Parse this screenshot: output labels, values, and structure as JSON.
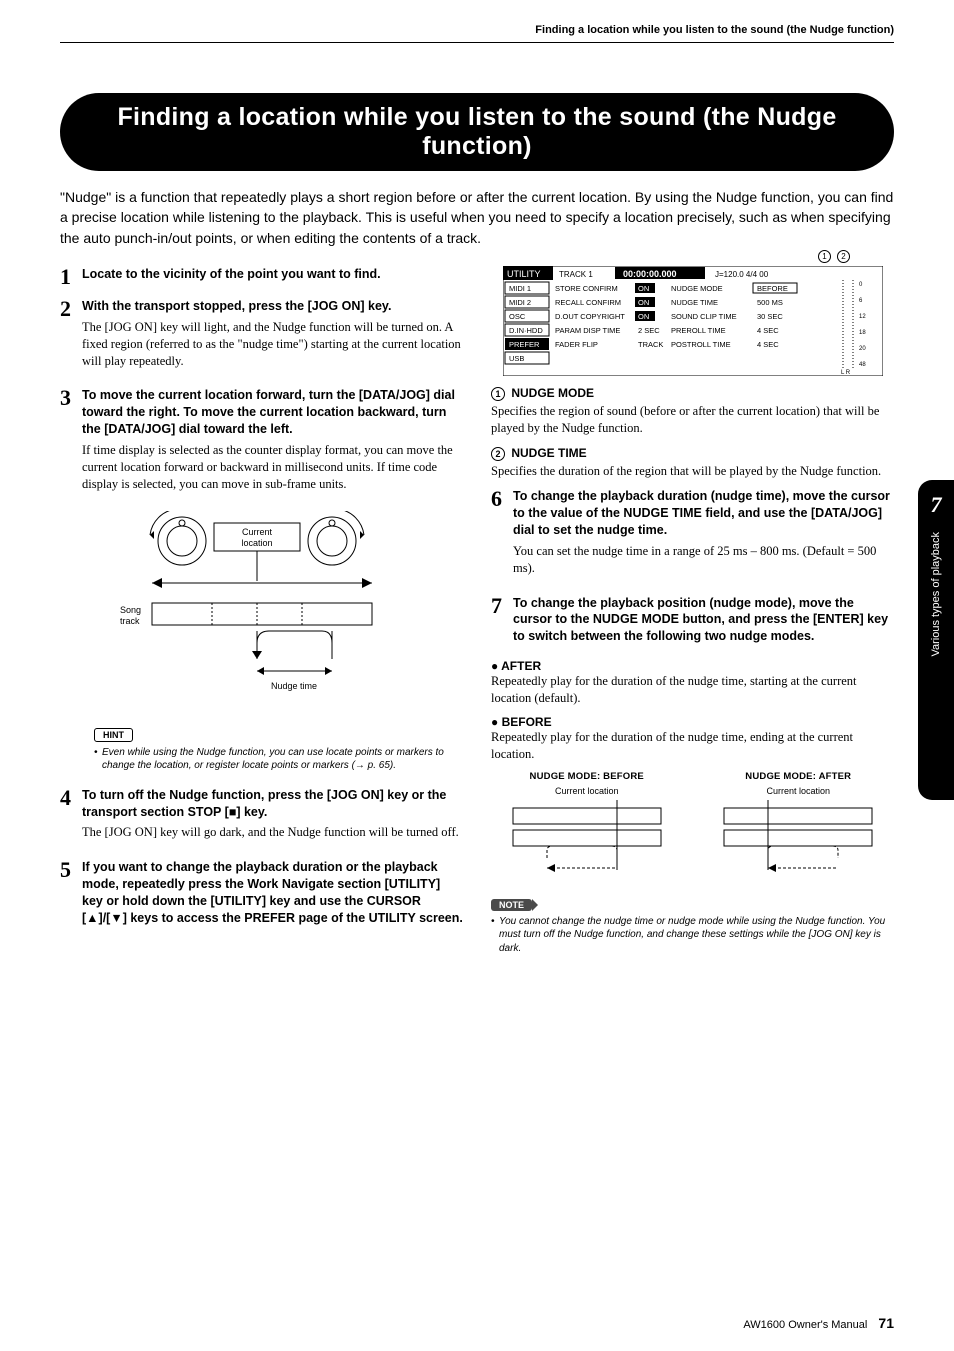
{
  "running_header": "Finding a location while you listen to the sound (the Nudge function)",
  "title": "Finding a location while you listen to the sound (the Nudge function)",
  "intro": "\"Nudge\" is a function that repeatedly plays a short region before or after the current location. By using the Nudge function, you can find a precise location while listening to the playback. This is useful when you need to specify a location precisely, such as when specifying the auto punch-in/out points, or when editing the contents of a track.",
  "steps": {
    "s1": {
      "n": "1",
      "head": "Locate to the vicinity of the point you want to find."
    },
    "s2": {
      "n": "2",
      "head": "With the transport stopped, press the [JOG ON] key.",
      "text": "The [JOG ON] key will light, and the Nudge function will be turned on. A fixed region (referred to as the \"nudge time\") starting at the current location will play repeatedly."
    },
    "s3": {
      "n": "3",
      "head": "To move the current location forward, turn the [DATA/JOG] dial toward the right. To move the current location backward, turn the [DATA/JOG] dial toward the left.",
      "text": "If time display is selected as the counter display format, you can move the current location forward or backward in millisecond units. If time code display is selected, you can move in sub-frame units."
    },
    "s4": {
      "n": "4",
      "head": "To turn off the Nudge function, press the [JOG ON] key or the transport section STOP [■] key.",
      "text": "The [JOG ON] key will go dark, and the Nudge function will be turned off."
    },
    "s5": {
      "n": "5",
      "head": "If you want to change the playback duration or the playback mode, repeatedly press the Work Navigate section [UTILITY] key or hold down the [UTILITY] key and use the CURSOR [▲]/[▼] keys to access the PREFER page of the UTILITY screen."
    },
    "s6": {
      "n": "6",
      "head": "To change the playback duration (nudge time), move the cursor to the value of the NUDGE TIME field, and use the [DATA/JOG] dial to set the nudge time.",
      "text": "You can set the nudge time in a range of 25 ms – 800 ms. (Default = 500 ms)."
    },
    "s7": {
      "n": "7",
      "head": "To change the playback position (nudge mode), move the cursor to the NUDGE MODE button, and press the [ENTER] key to switch between the following two nudge modes."
    }
  },
  "diagram": {
    "current_location": "Current\nlocation",
    "song_track": "Song\ntrack",
    "nudge_time": "Nudge time"
  },
  "hint": {
    "label": "HINT",
    "text": "Even while using the Nudge function, you can use locate points or markers to change the location, or register locate points or markers (→ p. 65)."
  },
  "screenshot": {
    "header": "UTILITY",
    "track": "TRACK 1",
    "time": "00:00:00.000",
    "tempo": "J=120.0 4/4 00",
    "callout1": "1",
    "callout2": "2",
    "rows": [
      {
        "left": "MIDI 1",
        "c1": "STORE CONFIRM",
        "c2": "ON",
        "c3": "NUDGE MODE",
        "c4": "BEFORE"
      },
      {
        "left": "MIDI 2",
        "c1": "RECALL CONFIRM",
        "c2": "ON",
        "c3": "NUDGE TIME",
        "c4": "500 MS"
      },
      {
        "left": "OSC",
        "c1": "D.OUT COPYRIGHT",
        "c2": "ON",
        "c3": "SOUND CLIP TIME",
        "c4": "30 SEC"
      },
      {
        "left": "D.IN·HDD",
        "c1": "PARAM DISP TIME",
        "c2": "2 SEC",
        "c3": "PREROLL TIME",
        "c4": "4 SEC"
      },
      {
        "left": "PREFER",
        "c1": "FADER FLIP",
        "c2": "TRACK",
        "c3": "POSTROLL TIME",
        "c4": "4 SEC"
      },
      {
        "left": "USB",
        "c1": "",
        "c2": "",
        "c3": "",
        "c4": ""
      }
    ],
    "meter": [
      "0",
      "6",
      "12",
      "18",
      "20",
      "48"
    ]
  },
  "params": {
    "nudge_mode": {
      "n": "1",
      "title": "NUDGE MODE",
      "text": "Specifies the region of sound (before or after the current location) that will be played by the Nudge function."
    },
    "nudge_time": {
      "n": "2",
      "title": "NUDGE TIME",
      "text": "Specifies the duration of the region that will be played by the Nudge function."
    }
  },
  "modes": {
    "after": {
      "head": "AFTER",
      "text": "Repeatedly play for the duration of the nudge time, starting at the current location (default)."
    },
    "before": {
      "head": "BEFORE",
      "text": "Repeatedly play for the duration of the nudge time, ending at the current location."
    }
  },
  "mode_diag": {
    "before_title": "NUDGE MODE: BEFORE",
    "after_title": "NUDGE MODE: AFTER",
    "cap": "Current location"
  },
  "note": {
    "label": "NOTE",
    "text": "You cannot change the nudge time or nudge mode while using the Nudge function. You must turn off the Nudge function, and change these settings while the [JOG ON] key is dark."
  },
  "side": {
    "chapter": "7",
    "label": "Various types of playback"
  },
  "footer": {
    "manual": "AW1600  Owner's Manual",
    "page": "71"
  }
}
